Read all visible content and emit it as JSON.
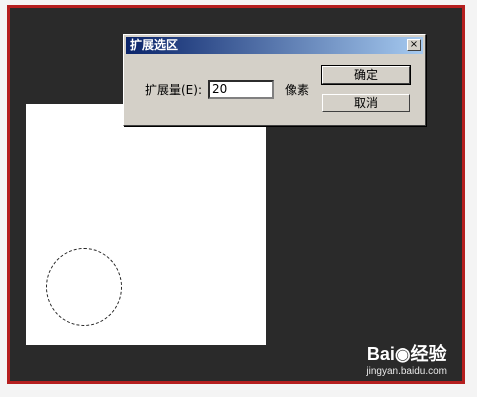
{
  "dialog": {
    "title": "扩展选区",
    "close_glyph": "×",
    "field_label": "扩展量(E):",
    "field_value": "20",
    "unit": "像素",
    "ok_label": "确定",
    "cancel_label": "取消"
  },
  "watermark": {
    "logo": "Bai◉经验",
    "url": "jingyan.baidu.com"
  },
  "colors": {
    "border": "#b51f1f",
    "workspace": "#2a2a2a",
    "titlebar_start": "#0a246a",
    "titlebar_end": "#a6caf0"
  }
}
